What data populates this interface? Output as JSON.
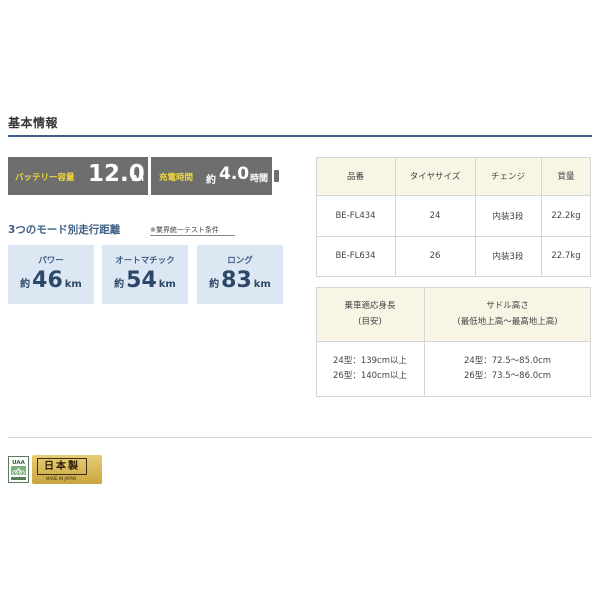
{
  "section": {
    "title": "基本情報"
  },
  "battery": {
    "capacity_label": "バッテリー容量",
    "capacity_value": "12.0",
    "capacity_unit": "Ah",
    "charge_label": "充電時間",
    "charge_prefix": "約",
    "charge_value": "4.0",
    "charge_unit": "時間"
  },
  "modes": {
    "heading": "3つのモード別走行距離",
    "note": "※業界統一テスト条件",
    "items": [
      {
        "label": "パワー",
        "prefix": "約",
        "value": "46",
        "unit": "km"
      },
      {
        "label": "オートマチック",
        "prefix": "約",
        "value": "54",
        "unit": "km"
      },
      {
        "label": "ロング",
        "prefix": "約",
        "value": "83",
        "unit": "km"
      }
    ]
  },
  "spec_table": {
    "headers": [
      "品番",
      "タイヤサイズ",
      "チェンジ",
      "質量"
    ],
    "rows": [
      [
        "BE-FL434",
        "24",
        "内装3段",
        "22.2kg"
      ],
      [
        "BE-FL634",
        "26",
        "内装3段",
        "22.7kg"
      ]
    ]
  },
  "fit_table": {
    "height_header_line1": "乗車適応身長",
    "height_header_line2": "(目安)",
    "saddle_header_line1": "サドル高さ",
    "saddle_header_line2": "(最低地上高～最高地上高)",
    "height_values": [
      "24型：139cm以上",
      "26型：140cm以上"
    ],
    "saddle_values": [
      "24型：72.5～85.0cm",
      "26型：73.5～86.0cm"
    ]
  },
  "badges": {
    "cert_text": "UAA",
    "made_in_japan": "日本製",
    "made_in_japan_sub": "MADE IN JAPAN"
  },
  "colors": {
    "accent": "#3e5f86",
    "banner_bg": "#6e6e6e",
    "banner_label": "#f3dc3c",
    "mode_card_bg": "#dde7f3",
    "table_head_bg": "#f8f5e4",
    "gold": "#d4b251"
  }
}
